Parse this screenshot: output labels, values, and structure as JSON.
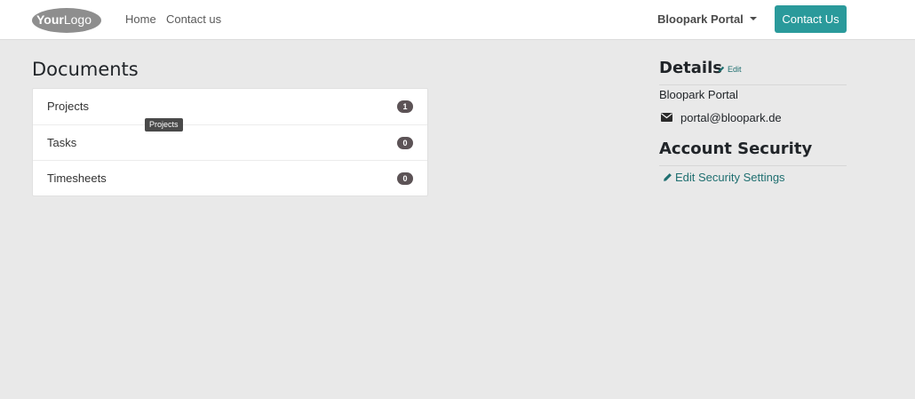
{
  "navbar": {
    "logo_text": "YourLogo",
    "links": [
      "Home",
      "Contact us"
    ],
    "portal_menu": "Bloopark Portal",
    "contact_button": "Contact Us"
  },
  "documents": {
    "title": "Documents",
    "items": [
      {
        "label": "Projects",
        "count": "1"
      },
      {
        "label": "Tasks",
        "count": "0"
      },
      {
        "label": "Timesheets",
        "count": "0"
      }
    ],
    "tooltip": "Projects"
  },
  "details": {
    "title": "Details",
    "edit_label": "Edit",
    "company": "Bloopark Portal",
    "email": "portal@bloopark.de"
  },
  "security": {
    "title": "Account Security",
    "link_label": "Edit Security Settings"
  },
  "colors": {
    "accent": "#2a9a9b",
    "link": "#1f6f70",
    "badge": "#5c5356",
    "background": "#e9e9e9"
  }
}
